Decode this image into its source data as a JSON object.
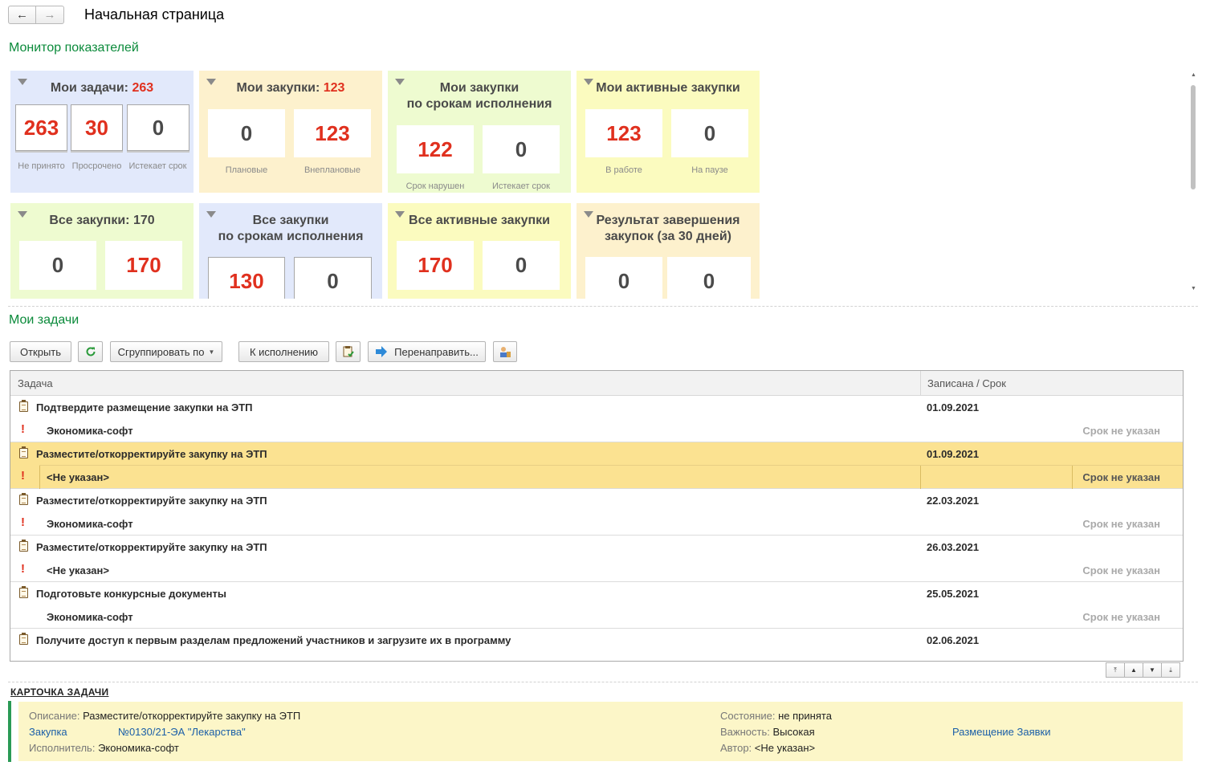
{
  "header": {
    "back_icon": "arrow-left-icon",
    "forward_icon": "arrow-right-icon",
    "title": "Начальная страница"
  },
  "monitor": {
    "title": "Монитор показателей",
    "tiles": [
      {
        "title": "Мои задачи: ",
        "count": "263",
        "color": "#e2e9fb",
        "boxes": [
          {
            "value": "263",
            "caption": "Не принято"
          },
          {
            "value": "30",
            "caption": "Просрочено"
          },
          {
            "value": "0",
            "caption": "Истекает срок"
          }
        ]
      },
      {
        "title": "Мои закупки: ",
        "count": "123",
        "color": "#fdf1cd",
        "boxes": [
          {
            "value": "0",
            "caption": "Плановые"
          },
          {
            "value": "123",
            "caption": "Внеплановые"
          }
        ]
      },
      {
        "title_line1": "Мои закупки",
        "title_line2": "по срокам исполнения",
        "color": "#eefbd0",
        "boxes": [
          {
            "value": "122",
            "caption": "Срок нарушен"
          },
          {
            "value": "0",
            "caption": "Истекает срок"
          }
        ]
      },
      {
        "title": "Мои активные закупки",
        "color": "#fbfbbf",
        "boxes": [
          {
            "value": "123",
            "caption": "В работе"
          },
          {
            "value": "0",
            "caption": "На паузе"
          }
        ]
      },
      {
        "title": "Все закупки: 170",
        "color": "#eefbd0",
        "boxes": [
          {
            "value": "0"
          },
          {
            "value": "170"
          }
        ]
      },
      {
        "title_line1": "Все закупки",
        "title_line2": "по срокам исполнения",
        "color": "#e2e9fb",
        "boxes": [
          {
            "value": "130"
          },
          {
            "value": "0"
          }
        ]
      },
      {
        "title": "Все активные закупки",
        "color": "#fbfbbf",
        "boxes": [
          {
            "value": "170"
          },
          {
            "value": "0"
          }
        ]
      },
      {
        "title_line1": "Результат завершения",
        "title_line2": "закупок (за 30 дней)",
        "color": "#fdf1cd",
        "boxes": [
          {
            "value": "0"
          },
          {
            "value": "0"
          }
        ]
      }
    ]
  },
  "tasks": {
    "title": "Мои задачи",
    "toolbar": {
      "open": "Открыть",
      "refresh_icon": "refresh-icon",
      "group_by": "Сгруппировать по",
      "to_execution": "К исполнению",
      "clipboard_icon": "clipboard-check-icon",
      "redirect": "Перенаправить...",
      "users_icon": "users-settings-icon"
    },
    "columns": {
      "task": "Задача",
      "date": "Записана / Срок"
    },
    "rows": [
      {
        "name": "Подтвердите размещение закупки на ЭТП",
        "executor": "Экономика-софт",
        "date": "01.09.2021",
        "due": "Срок не указан",
        "important": true
      },
      {
        "name": "Разместите/откорректируйте закупку на ЭТП",
        "executor": "<Не указан>",
        "date": "01.09.2021",
        "due": "Срок не указан",
        "important": true,
        "selected": true
      },
      {
        "name": "Разместите/откорректируйте закупку на ЭТП",
        "executor": "Экономика-софт",
        "date": "22.03.2021",
        "due": "Срок не указан",
        "important": true
      },
      {
        "name": "Разместите/откорректируйте закупку на ЭТП",
        "executor": "<Не указан>",
        "date": "26.03.2021",
        "due": "Срок не указан",
        "important": true
      },
      {
        "name": "Подготовьте конкурсные документы",
        "executor": "Экономика-софт",
        "date": "25.05.2021",
        "due": "Срок не указан",
        "important": false
      },
      {
        "name": "Получите доступ к первым разделам предложений участников и загрузите их в программу",
        "executor": "",
        "date": "02.06.2021",
        "due": "",
        "important": false
      }
    ],
    "accent_color": "#fbe291"
  },
  "card": {
    "title": "КАРТОЧКА ЗАДАЧИ",
    "description_label": "Описание:",
    "description": "Разместите/откорректируйте закупку на ЭТП",
    "purchase_label": "Закупка",
    "purchase": "№0130/21-ЭА \"Лекарства\"",
    "executor_label": "Исполнитель:",
    "executor": "Экономика-софт",
    "state_label": "Состояние:",
    "state": "не принята",
    "importance_label": "Важность:",
    "importance": "Высокая",
    "author_label": "Автор:",
    "author": "<Не указан>",
    "link": "Размещение Заявки"
  }
}
